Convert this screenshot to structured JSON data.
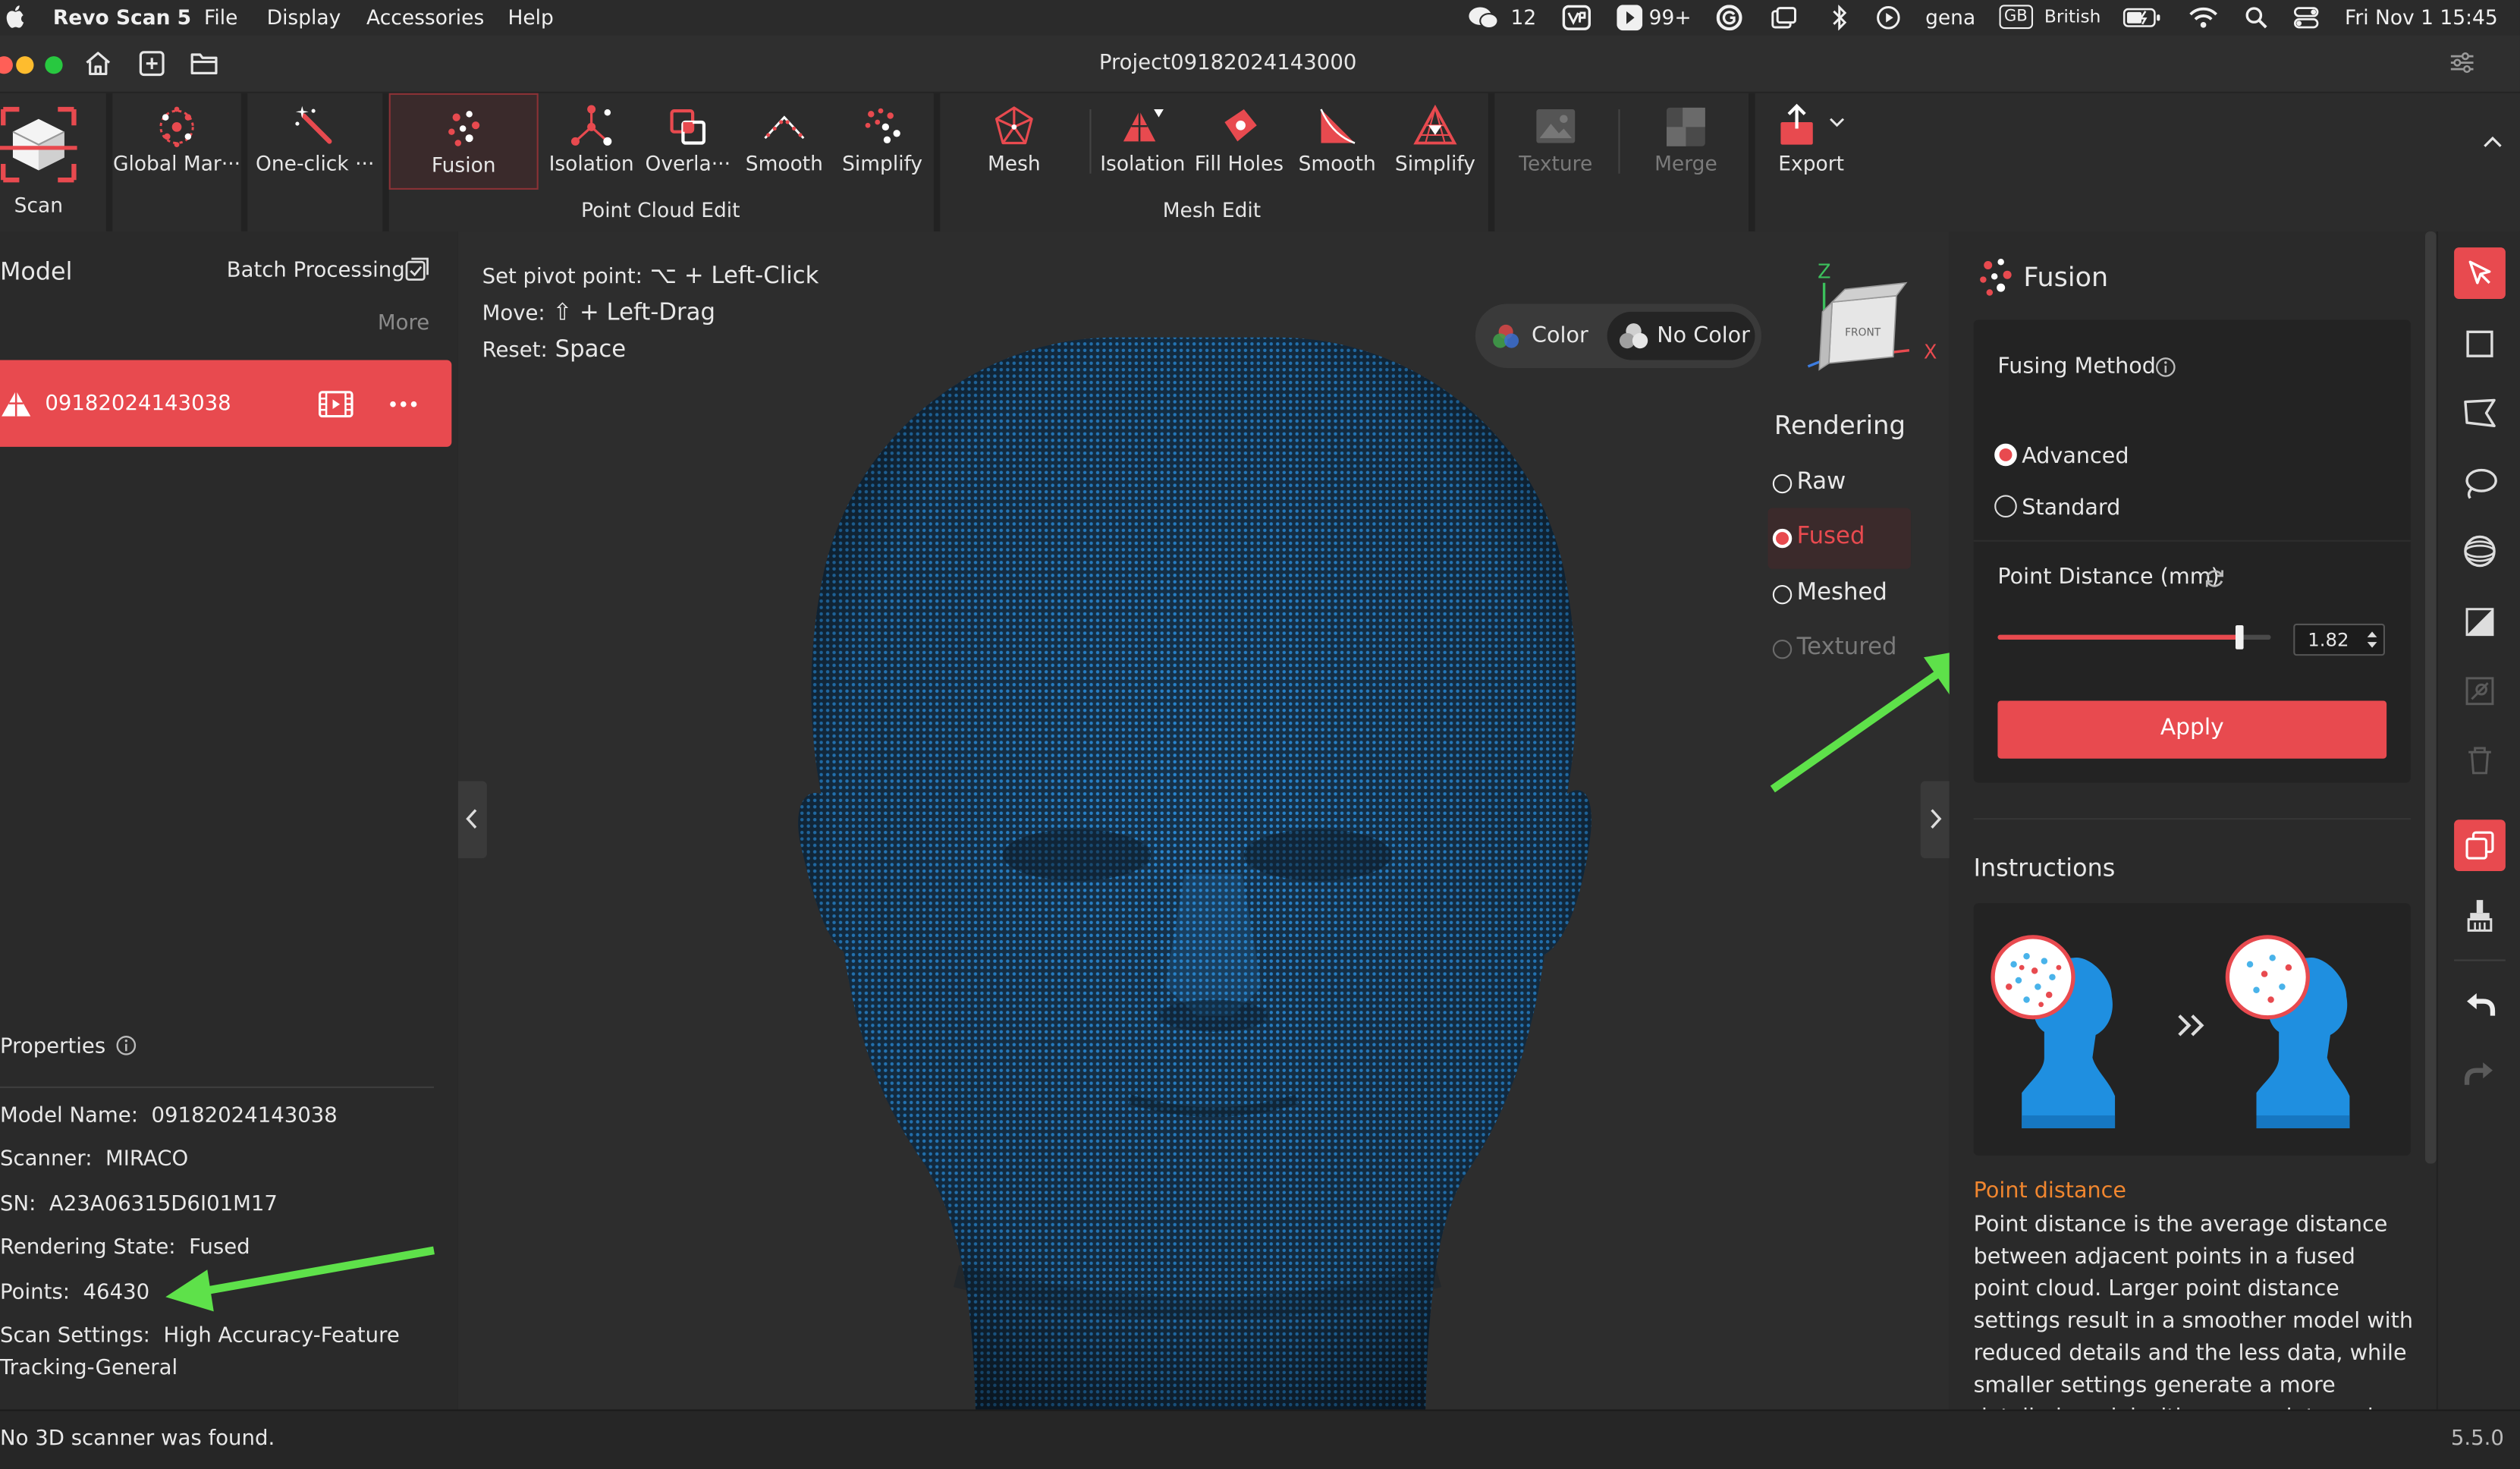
{
  "menubar": {
    "app_name": "Revo Scan 5",
    "menus": [
      "File",
      "Display",
      "Accessories",
      "Help"
    ],
    "status": {
      "wechat_count": "12",
      "badge_count": "99+",
      "user": "gena",
      "input_code": "GB",
      "input_name": "British",
      "datetime": "Fri Nov 1  15:45"
    }
  },
  "titlebar": {
    "title": "Project09182024143000"
  },
  "toolbar": {
    "scan": "Scan",
    "global_markers": "Global Mar···",
    "one_click": "One-click ···",
    "point_cloud_tools": [
      "Fusion",
      "Isolation",
      "Overla···",
      "Smooth",
      "Simplify"
    ],
    "point_cloud_group": "Point Cloud Edit",
    "mesh_tools": [
      "Mesh",
      "Isolation",
      "Fill Holes",
      "Smooth",
      "Simplify"
    ],
    "mesh_group": "Mesh Edit",
    "texture": "Texture",
    "merge": "Merge",
    "export": "Export"
  },
  "left_panel": {
    "model_title": "Model",
    "batch_processing": "Batch Processing",
    "more": "More",
    "model_item": "09182024143038",
    "properties_title": "Properties",
    "properties": [
      {
        "label": "Model Name:",
        "value": "09182024143038"
      },
      {
        "label": "Scanner:",
        "value": "MIRACO"
      },
      {
        "label": "SN:",
        "value": "A23A06315D6I01M17"
      },
      {
        "label": "Rendering State:",
        "value": "Fused"
      },
      {
        "label": "Points:",
        "value": "46430"
      },
      {
        "label": "Scan Settings:",
        "value": "High Accuracy-Feature"
      }
    ],
    "scan_settings_line2": "Tracking-General"
  },
  "viewport": {
    "hints": [
      {
        "label": "Set pivot point:",
        "value": "⌥ + Left-Click"
      },
      {
        "label": "Move:",
        "value": "⇧ + Left-Drag"
      },
      {
        "label": "Reset:",
        "value": "Space"
      }
    ],
    "color_toggle": {
      "color": "Color",
      "no_color": "No Color",
      "active": "No Color"
    },
    "axis": {
      "z": "Z",
      "x": "X",
      "face": "FRONT"
    },
    "rendering": {
      "title": "Rendering",
      "options": [
        "Raw",
        "Fused",
        "Meshed",
        "Textured"
      ],
      "selected": "Fused"
    }
  },
  "right_panel": {
    "title": "Fusion",
    "fusing_method_label": "Fusing Method",
    "methods": [
      "Advanced",
      "Standard"
    ],
    "selected_method": "Advanced",
    "point_distance_label": "Point Distance (mm)",
    "point_distance_value": "1.82",
    "slider_fraction": 0.885,
    "apply": "Apply",
    "instructions_title": "Instructions",
    "instructions_subtitle": "Point distance",
    "instructions_body": "Point distance is the average distance between adjacent points in a fused point cloud. Larger point distance settings result in a smoother model with reduced details and the less data, while smaller settings generate a more detailed model with more points and data."
  },
  "statusbar": {
    "message": "No 3D scanner was found.",
    "version": "5.5.0"
  },
  "colors": {
    "accent": "#e84a4f",
    "mesh_blue": "#1f6fb0",
    "annotation_arrow": "#5ee14a",
    "orange_subtitle": "#f0862f"
  }
}
